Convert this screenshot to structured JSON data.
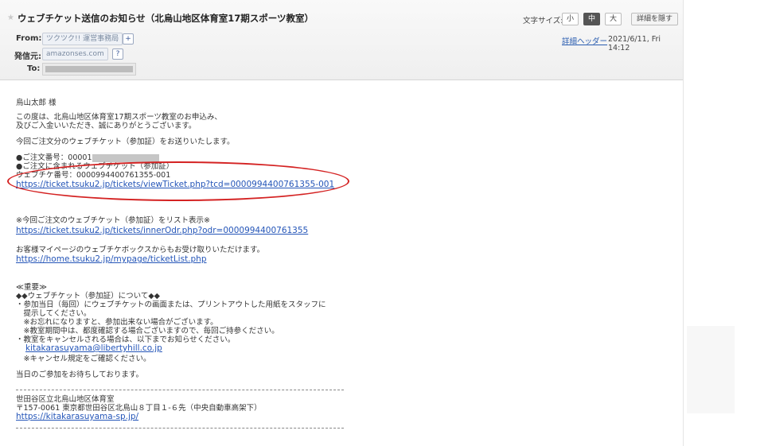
{
  "header": {
    "subject": "ウェブチケット送信のお知らせ（北烏山地区体育室17期スポーツ教室）",
    "font_size_label": "文字サイズ:",
    "font_sizes": [
      "小",
      "中",
      "大"
    ],
    "font_size_selected": "中",
    "hide_details": "詳細を隠す",
    "from_label": "From:",
    "from_value": "ツクツク!! 運営事務局",
    "sender_label": "発信元:",
    "sender_value": "amazonses.com",
    "to_label": "To:",
    "detail_header_link": "詳細ヘッダー",
    "date": "2021/6/11, Fri 14:12"
  },
  "body": {
    "greeting": "烏山太郎 様",
    "intro_1": "この度は、北烏山地区体育室17期スポーツ教室のお申込み、",
    "intro_2": "及びご入金いいただき、誠にありがとうございます。",
    "send_line": "今回ご注文分のウェブチケット（参加証）をお送りいたします。",
    "order_no": "●ご注文番号：00001",
    "included": "●ご注文に含まれるウェブチケット（参加証）",
    "ticket_no": "ウェブチケ番号：0000994400761355-001",
    "ticket_link": "https://ticket.tsuku2.jp/tickets/viewTicket.php?tcd=0000994400761355-001",
    "list_heading": "※今回ご注文のウェブチケット（参加証）をリスト表示※",
    "list_link": "https://ticket.tsuku2.jp/tickets/innerOdr.php?odr=0000994400761355",
    "mypage_text": "お客様マイページのウェブチケボックスからもお受け取りいただけます。",
    "mypage_link": "https://home.tsuku2.jp/mypage/ticketList.php",
    "important_heading": "≪重要≫",
    "important_sub": "◆◆ウェブチケット（参加証）について◆◆",
    "important_1": "・参加当日（毎回）にウェブチケットの画面または、プリントアウトした用紙をスタッフに",
    "important_2": "　提示してください。",
    "important_3": "　※お忘れになりますと、参加出来ない場合がございます。",
    "important_4": "　※教室期間中は、都度確認する場合ございますので、毎回ご持参ください。",
    "important_5": "・教室をキャンセルされる場合は、以下までお知らせください。",
    "contact_email": "kitakarasuyama@libertyhill.co.jp",
    "cancel_note": "　※キャンセル規定をご確認ください。",
    "closing": "当日のご参加をお待ちしております。",
    "footer_org": "世田谷区立北烏山地区体育室",
    "footer_addr": "〒157-0061 東京都世田谷区北烏山８丁目１-６先（中央自動車高架下）",
    "footer_link": "https://kitakarasuyama-sp.jp/"
  },
  "colors": {
    "link": "#2455b8",
    "highlight_ellipse": "#d42222",
    "selected_font_size": "#555555"
  }
}
